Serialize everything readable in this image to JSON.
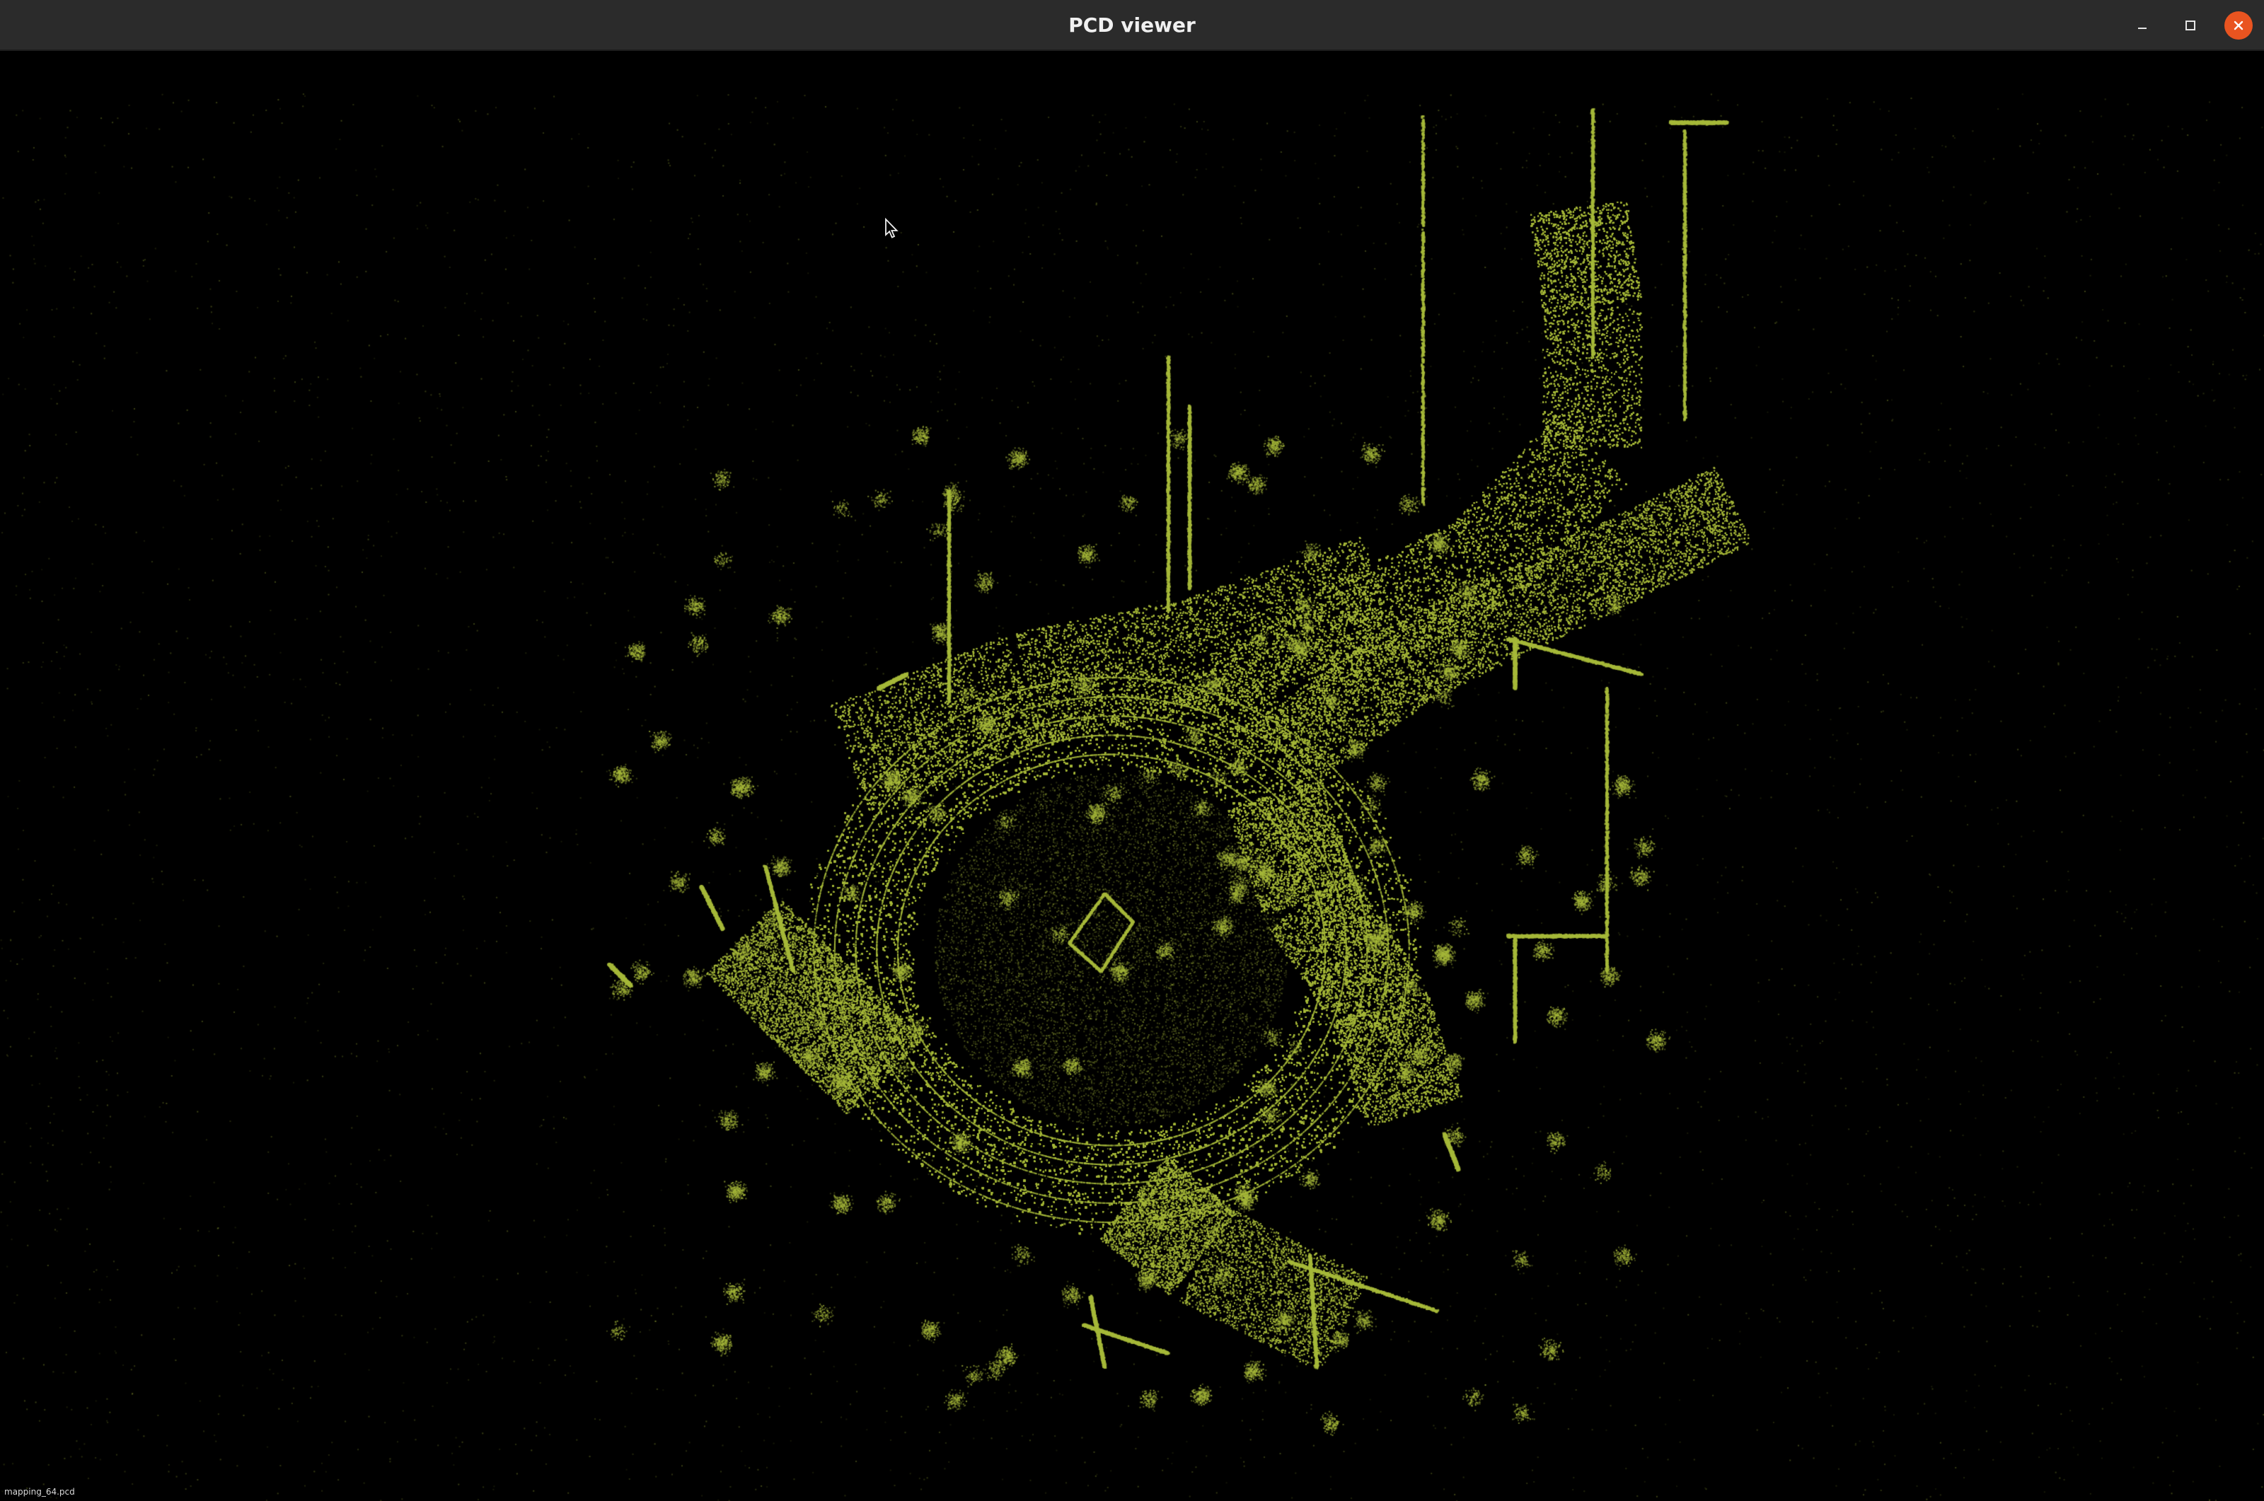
{
  "window": {
    "title": "PCD viewer",
    "buttons": {
      "minimize_icon": "minimize-icon",
      "maximize_icon": "maximize-icon",
      "close_icon": "close-icon"
    },
    "colors": {
      "titlebar": "#2b2b2b",
      "title_text": "#f0f0f0",
      "close_button": "#e95420"
    }
  },
  "viewer": {
    "background_color": "#000000",
    "point_color": "#a6b83a",
    "status_text": "mapping_64.pcd"
  }
}
